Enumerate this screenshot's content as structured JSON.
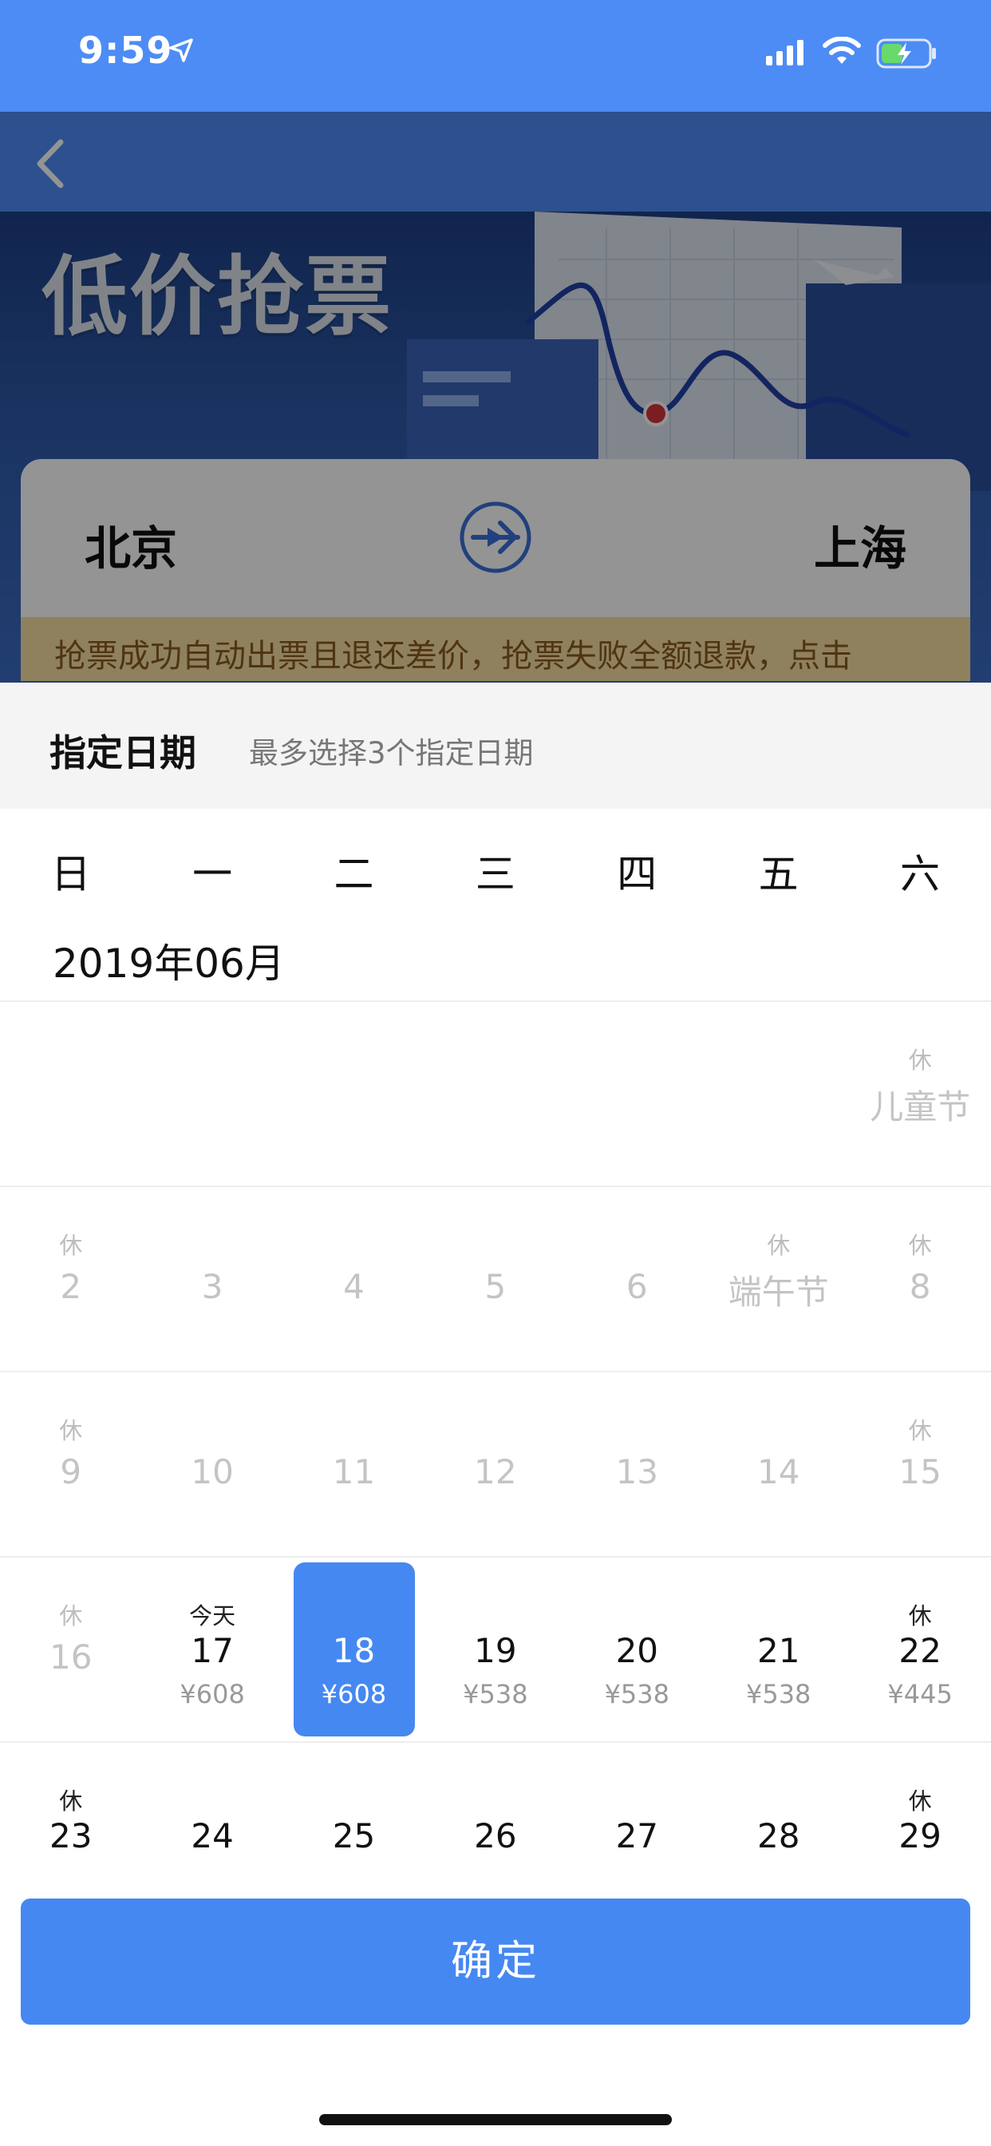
{
  "status_bar": {
    "time": "9:59"
  },
  "banner": {
    "promo_title": "低价抢票"
  },
  "route": {
    "from": "北京",
    "to": "上海"
  },
  "notice": {
    "text": "抢票成功自动出票且退还差价，抢票失败全额退款，点击"
  },
  "sheet": {
    "title": "指定日期",
    "subtitle": "最多选择3个指定日期"
  },
  "weekdays": [
    "日",
    "一",
    "二",
    "三",
    "四",
    "五",
    "六"
  ],
  "month_label": "2019年06月",
  "holiday_tag": "休",
  "today_tag": "今天",
  "weeks": [
    {
      "days": [
        "",
        "",
        "",
        "",
        "",
        "",
        "儿童节"
      ],
      "tags": [
        "",
        "",
        "",
        "",
        "",
        "",
        "休"
      ]
    },
    {
      "days": [
        "2",
        "3",
        "4",
        "5",
        "6",
        "端午节",
        "8"
      ],
      "tags": [
        "休",
        "",
        "",
        "",
        "",
        "休",
        "休"
      ]
    },
    {
      "days": [
        "9",
        "10",
        "11",
        "12",
        "13",
        "14",
        "15"
      ],
      "tags": [
        "休",
        "",
        "",
        "",
        "",
        "",
        "休"
      ]
    },
    {
      "days": [
        "16",
        "17",
        "18",
        "19",
        "20",
        "21",
        "22"
      ],
      "tags": [
        "休",
        "今天",
        "",
        "",
        "",
        "",
        "休"
      ],
      "prices": [
        "",
        "¥608",
        "¥608",
        "¥538",
        "¥538",
        "¥538",
        "¥445"
      ]
    },
    {
      "days": [
        "23",
        "24",
        "25",
        "26",
        "27",
        "28",
        "29"
      ],
      "tags": [
        "休",
        "",
        "",
        "",
        "",
        "",
        "休"
      ]
    }
  ],
  "selected_date": "18",
  "confirm_label": "确定",
  "colors": {
    "primary": "#4688f1",
    "header_blue": "#4d8cf5",
    "muted": "#c4c4c4"
  }
}
